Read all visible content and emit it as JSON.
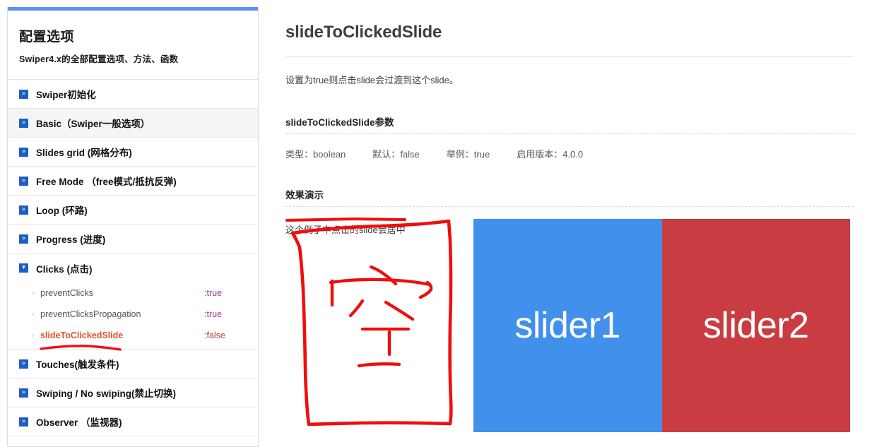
{
  "sidebar": {
    "accent_color": "#5b92f0",
    "title": "配置选项",
    "subtitle": "Swiper4.x的全部配置选项、方法、函数",
    "items": [
      {
        "label": "Swiper初始化",
        "icon": "chevron-double-right-icon",
        "state": "collapsed",
        "highlighted": false
      },
      {
        "label": "Basic（Swiper一般选项）",
        "icon": "chevron-double-right-icon",
        "state": "collapsed",
        "highlighted": true
      },
      {
        "label": "Slides grid (网格分布)",
        "icon": "chevron-double-right-icon",
        "state": "collapsed",
        "highlighted": false
      },
      {
        "label": "Free Mode （free模式/抵抗反弹)",
        "icon": "chevron-double-right-icon",
        "state": "collapsed",
        "highlighted": false
      },
      {
        "label": "Loop (环路)",
        "icon": "chevron-double-right-icon",
        "state": "collapsed",
        "highlighted": false
      },
      {
        "label": "Progress (进度)",
        "icon": "chevron-double-right-icon",
        "state": "collapsed",
        "highlighted": false
      },
      {
        "label": "Clicks (点击)",
        "icon": "chevron-down-icon",
        "state": "expanded",
        "highlighted": false
      }
    ],
    "clicks_children": [
      {
        "arrow": "chevron-right-icon",
        "name": "preventClicks",
        "value": ":true",
        "current": false
      },
      {
        "arrow": "chevron-right-icon",
        "name": "preventClicksPropagation",
        "value": ":true",
        "current": false
      },
      {
        "arrow": "chevron-right-icon",
        "name": "slideToClickedSlide",
        "value": ":false",
        "current": true
      }
    ],
    "items_after": [
      {
        "label": "Touches(触发条件)",
        "icon": "chevron-double-right-icon",
        "state": "collapsed",
        "highlighted": false
      },
      {
        "label": "Swiping / No swiping(禁止切换)",
        "icon": "chevron-double-right-icon",
        "state": "collapsed",
        "highlighted": false
      },
      {
        "label": "Observer （监视器)",
        "icon": "chevron-double-right-icon",
        "state": "collapsed",
        "highlighted": false
      }
    ],
    "active_color": "#e8502a",
    "value_color": "#9b3f8c"
  },
  "main": {
    "title": "slideToClickedSlide",
    "description": "设置为true则点击slide会过渡到这个slide。",
    "params_heading": "slideToClickedSlide参数",
    "params": [
      {
        "label": "类型：",
        "value": "boolean"
      },
      {
        "label": "默认：",
        "value": "false"
      },
      {
        "label": "举例：",
        "value": "true"
      },
      {
        "label": "启用版本：",
        "value": "4.0.0"
      }
    ],
    "demo_heading": "效果演示",
    "demo_note": "这个例子中点击的slide会居中"
  },
  "demo": {
    "slides": [
      {
        "label": "slider1",
        "color": "#4190ec"
      },
      {
        "label": "slider2",
        "color": "#c93c42"
      }
    ]
  },
  "annotation": {
    "color": "#f10d0d",
    "description": "手绘红色批注：下划线与方框内手写汉字"
  }
}
